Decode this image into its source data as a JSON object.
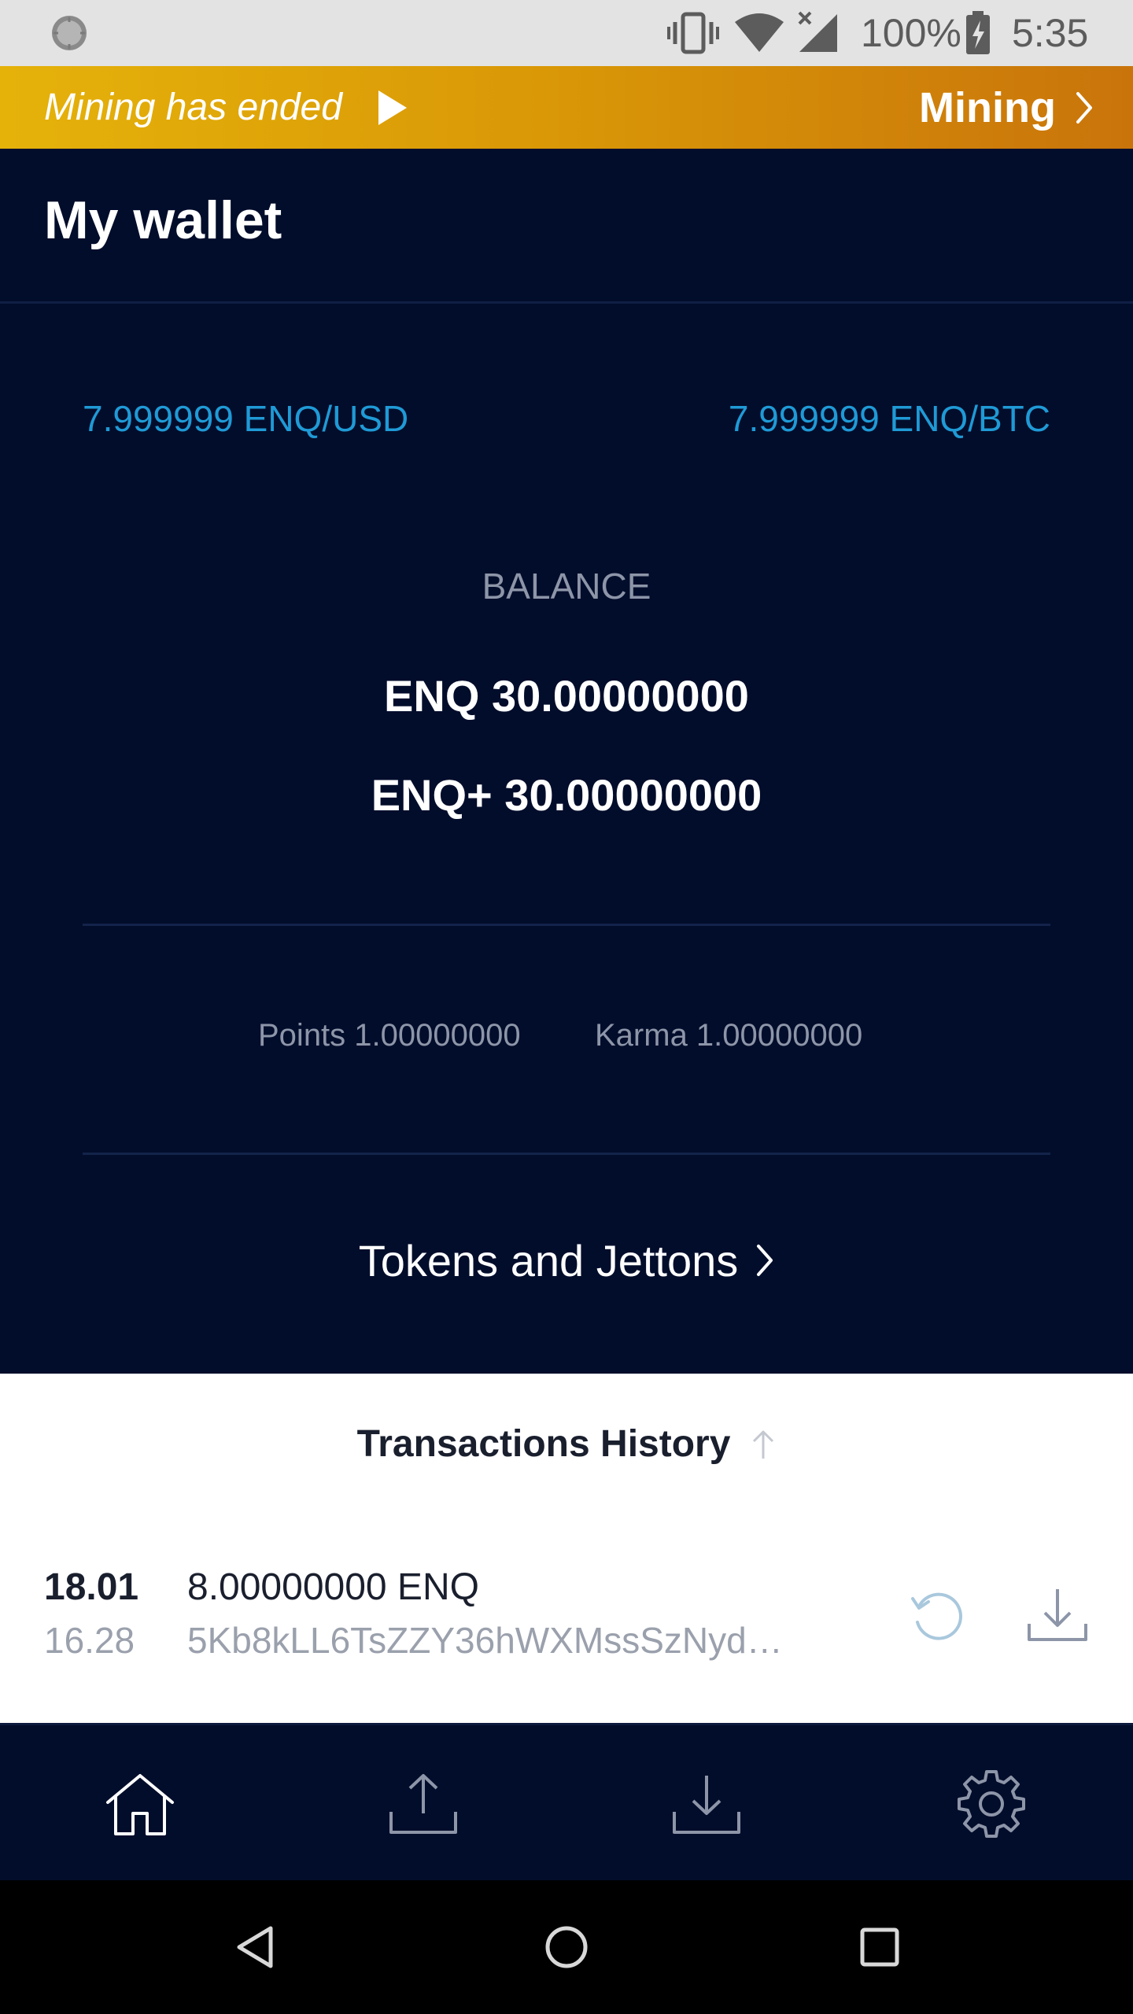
{
  "status_bar": {
    "battery": "100%",
    "time": "5:35",
    "icons": [
      "sync-icon",
      "vibrate-icon",
      "wifi-icon",
      "signal-icon",
      "battery-charging-icon"
    ]
  },
  "banner": {
    "status_text": "Mining has ended",
    "link_label": "Mining",
    "colors": {
      "start": "#e5b20a",
      "end": "#c9740b"
    }
  },
  "header": {
    "title": "My wallet"
  },
  "rates": {
    "usd": "7.999999 ENQ/USD",
    "btc": "7.999999 ENQ/BTC"
  },
  "balance": {
    "label": "BALANCE",
    "enq": "ENQ 30.00000000",
    "enq_plus": "ENQ+ 30.00000000"
  },
  "stats": {
    "points": "Points 1.00000000",
    "karma": "Karma 1.00000000"
  },
  "tokens": {
    "label": "Tokens and Jettons"
  },
  "history": {
    "title": "Transactions History",
    "transactions": [
      {
        "date": "18.01",
        "time": "16.28",
        "amount": "8.00000000 ENQ",
        "hash": "5Kb8kLL6TsZZY36hWXMssSzNyd…",
        "status_icon": "pending-refresh-icon",
        "type_icon": "incoming-download-icon"
      }
    ]
  },
  "bottom_nav": {
    "items": [
      "home-icon",
      "send-upload-icon",
      "receive-download-icon",
      "settings-gear-icon"
    ],
    "active": "home-icon"
  },
  "system_nav": {
    "items": [
      "back-icon",
      "home-circle-icon",
      "recents-square-icon"
    ]
  },
  "colors": {
    "background": "#020d2b",
    "accent_blue": "#1f9ad6",
    "muted_text": "#8d95a8"
  }
}
